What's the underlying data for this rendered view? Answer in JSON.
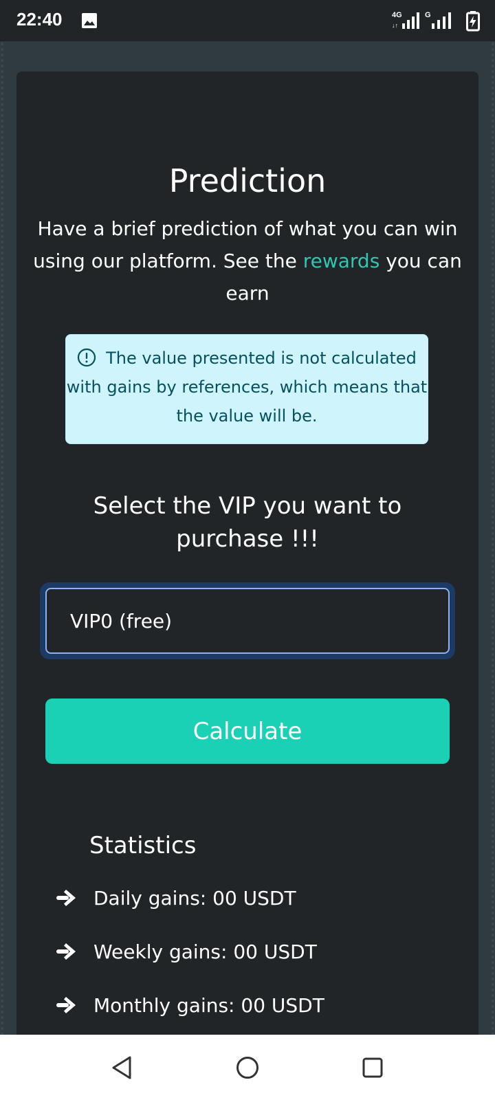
{
  "status_bar": {
    "time": "22:40",
    "icons": [
      "gallery-icon",
      "signal-4g-icon",
      "signal-g-icon",
      "battery-charging-icon"
    ],
    "network_labels": [
      "4G",
      "G"
    ]
  },
  "prediction": {
    "title": "Prediction",
    "intro_before_link": "Have a brief prediction of what you can win using our platform. See the ",
    "intro_link": "rewards",
    "intro_after_link": " you can earn",
    "link_color": "#2fc6b3"
  },
  "alert": {
    "icon": "info-circle-icon",
    "text": "The value presented is not calculated with gains by references, which means that the value will be."
  },
  "vip": {
    "heading": "Select the VIP you want to purchase !!!",
    "selected": "VIP0 (free)"
  },
  "calculate_button": {
    "label": "Calculate",
    "color": "#1ad1b5"
  },
  "statistics": {
    "title": "Statistics",
    "items": [
      {
        "label": "Daily gains: 00 USDT"
      },
      {
        "label": "Weekly gains: 00 USDT"
      },
      {
        "label": "Monthly gains: 00 USDT"
      }
    ]
  },
  "nav_bar": {
    "icons": [
      "back-icon",
      "home-icon",
      "recent-apps-icon"
    ]
  }
}
